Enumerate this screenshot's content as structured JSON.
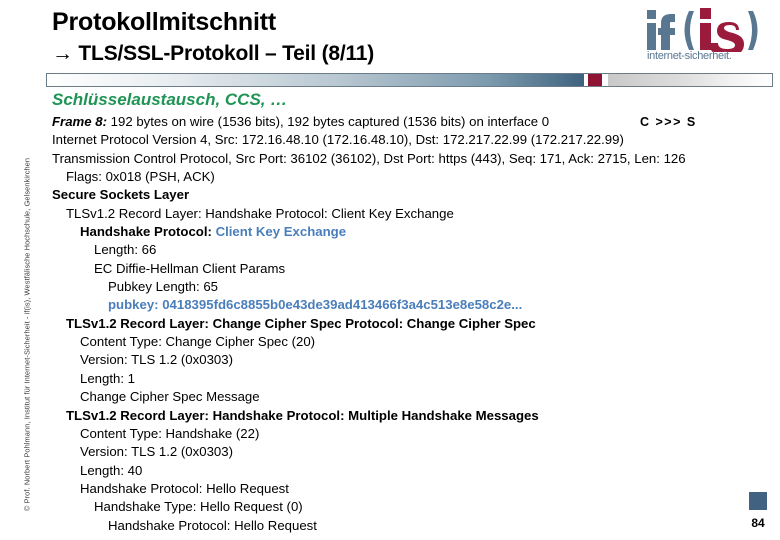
{
  "header": {
    "title": "Protokollmitschnitt",
    "subtitle": "→ TLS/SSL-Protokoll – Teil (8/11)"
  },
  "logo": {
    "mark_text": "if(is)",
    "caption": "internet-sicherheit.",
    "blue": "#5a7792",
    "red": "#9b1b3c"
  },
  "progress_rule": {
    "filled_color": "#3f627e",
    "marker_color": "#8f1433",
    "remaining_color": "#d4d4d4"
  },
  "section": {
    "heading": "Schlüsselaustausch, CCS, …",
    "heading_color": "#1f9455"
  },
  "capture": {
    "direction_note": "C  >>>  S",
    "highlight_color": "#4a7ebb",
    "lines": [
      {
        "indent": 0,
        "bold": false,
        "kw": "Frame 8:",
        "text": " 192 bytes on wire (1536 bits), 192 bytes captured (1536 bits) on interface 0"
      },
      {
        "indent": 0,
        "bold": false,
        "text": "Internet Protocol Version 4, Src: 172.16.48.10 (172.16.48.10), Dst: 172.217.22.99 (172.217.22.99)"
      },
      {
        "indent": 0,
        "bold": false,
        "text": "Transmission Control Protocol, Src Port: 36102 (36102), Dst Port: https (443), Seq: 171, Ack: 2715, Len: 126"
      },
      {
        "indent": 1,
        "bold": false,
        "text": "Flags: 0x018 (PSH, ACK)"
      },
      {
        "indent": 0,
        "bold": true,
        "text": "Secure Sockets Layer"
      },
      {
        "indent": 1,
        "bold": false,
        "text": "TLSv1.2 Record Layer: Handshake Protocol: Client Key Exchange"
      },
      {
        "indent": 2,
        "bold": true,
        "label": "Handshake Protocol: ",
        "value": "Client Key Exchange"
      },
      {
        "indent": 3,
        "bold": false,
        "text": "Length: 66"
      },
      {
        "indent": 3,
        "bold": false,
        "text": "EC Diffie-Hellman Client Params"
      },
      {
        "indent": 4,
        "bold": false,
        "text": "Pubkey Length: 65"
      },
      {
        "indent": 4,
        "bold": true,
        "hex": "pubkey: 0418395fd6c8855b0e43de39ad413466f3a4c513e8e58c2e..."
      },
      {
        "indent": 1,
        "bold": true,
        "text": "TLSv1.2 Record Layer: Change Cipher Spec Protocol: Change Cipher Spec"
      },
      {
        "indent": 2,
        "bold": false,
        "text": "Content Type: Change Cipher Spec (20)"
      },
      {
        "indent": 2,
        "bold": false,
        "text": "Version: TLS 1.2 (0x0303)"
      },
      {
        "indent": 2,
        "bold": false,
        "text": "Length: 1"
      },
      {
        "indent": 2,
        "bold": false,
        "text": "Change Cipher Spec Message"
      },
      {
        "indent": 1,
        "bold": true,
        "text": "TLSv1.2 Record Layer: Handshake Protocol: Multiple Handshake Messages"
      },
      {
        "indent": 2,
        "bold": false,
        "text": "Content Type: Handshake (22)"
      },
      {
        "indent": 2,
        "bold": false,
        "text": "Version: TLS 1.2 (0x0303)"
      },
      {
        "indent": 2,
        "bold": false,
        "text": "Length: 40"
      },
      {
        "indent": 2,
        "bold": false,
        "text": "Handshake Protocol: Hello Request"
      },
      {
        "indent": 3,
        "bold": false,
        "text": "Handshake Type: Hello Request (0)"
      },
      {
        "indent": 4,
        "bold": false,
        "text": "Handshake Protocol: Hello Request"
      }
    ]
  },
  "footer": {
    "copyright": "© Prof. Norbert Pohlmann, Institut für Internet-Sicherheit - if(is), Westfälische Hochschule, Gelsenkirchen",
    "page_number": "84",
    "square_color": "#416381"
  }
}
